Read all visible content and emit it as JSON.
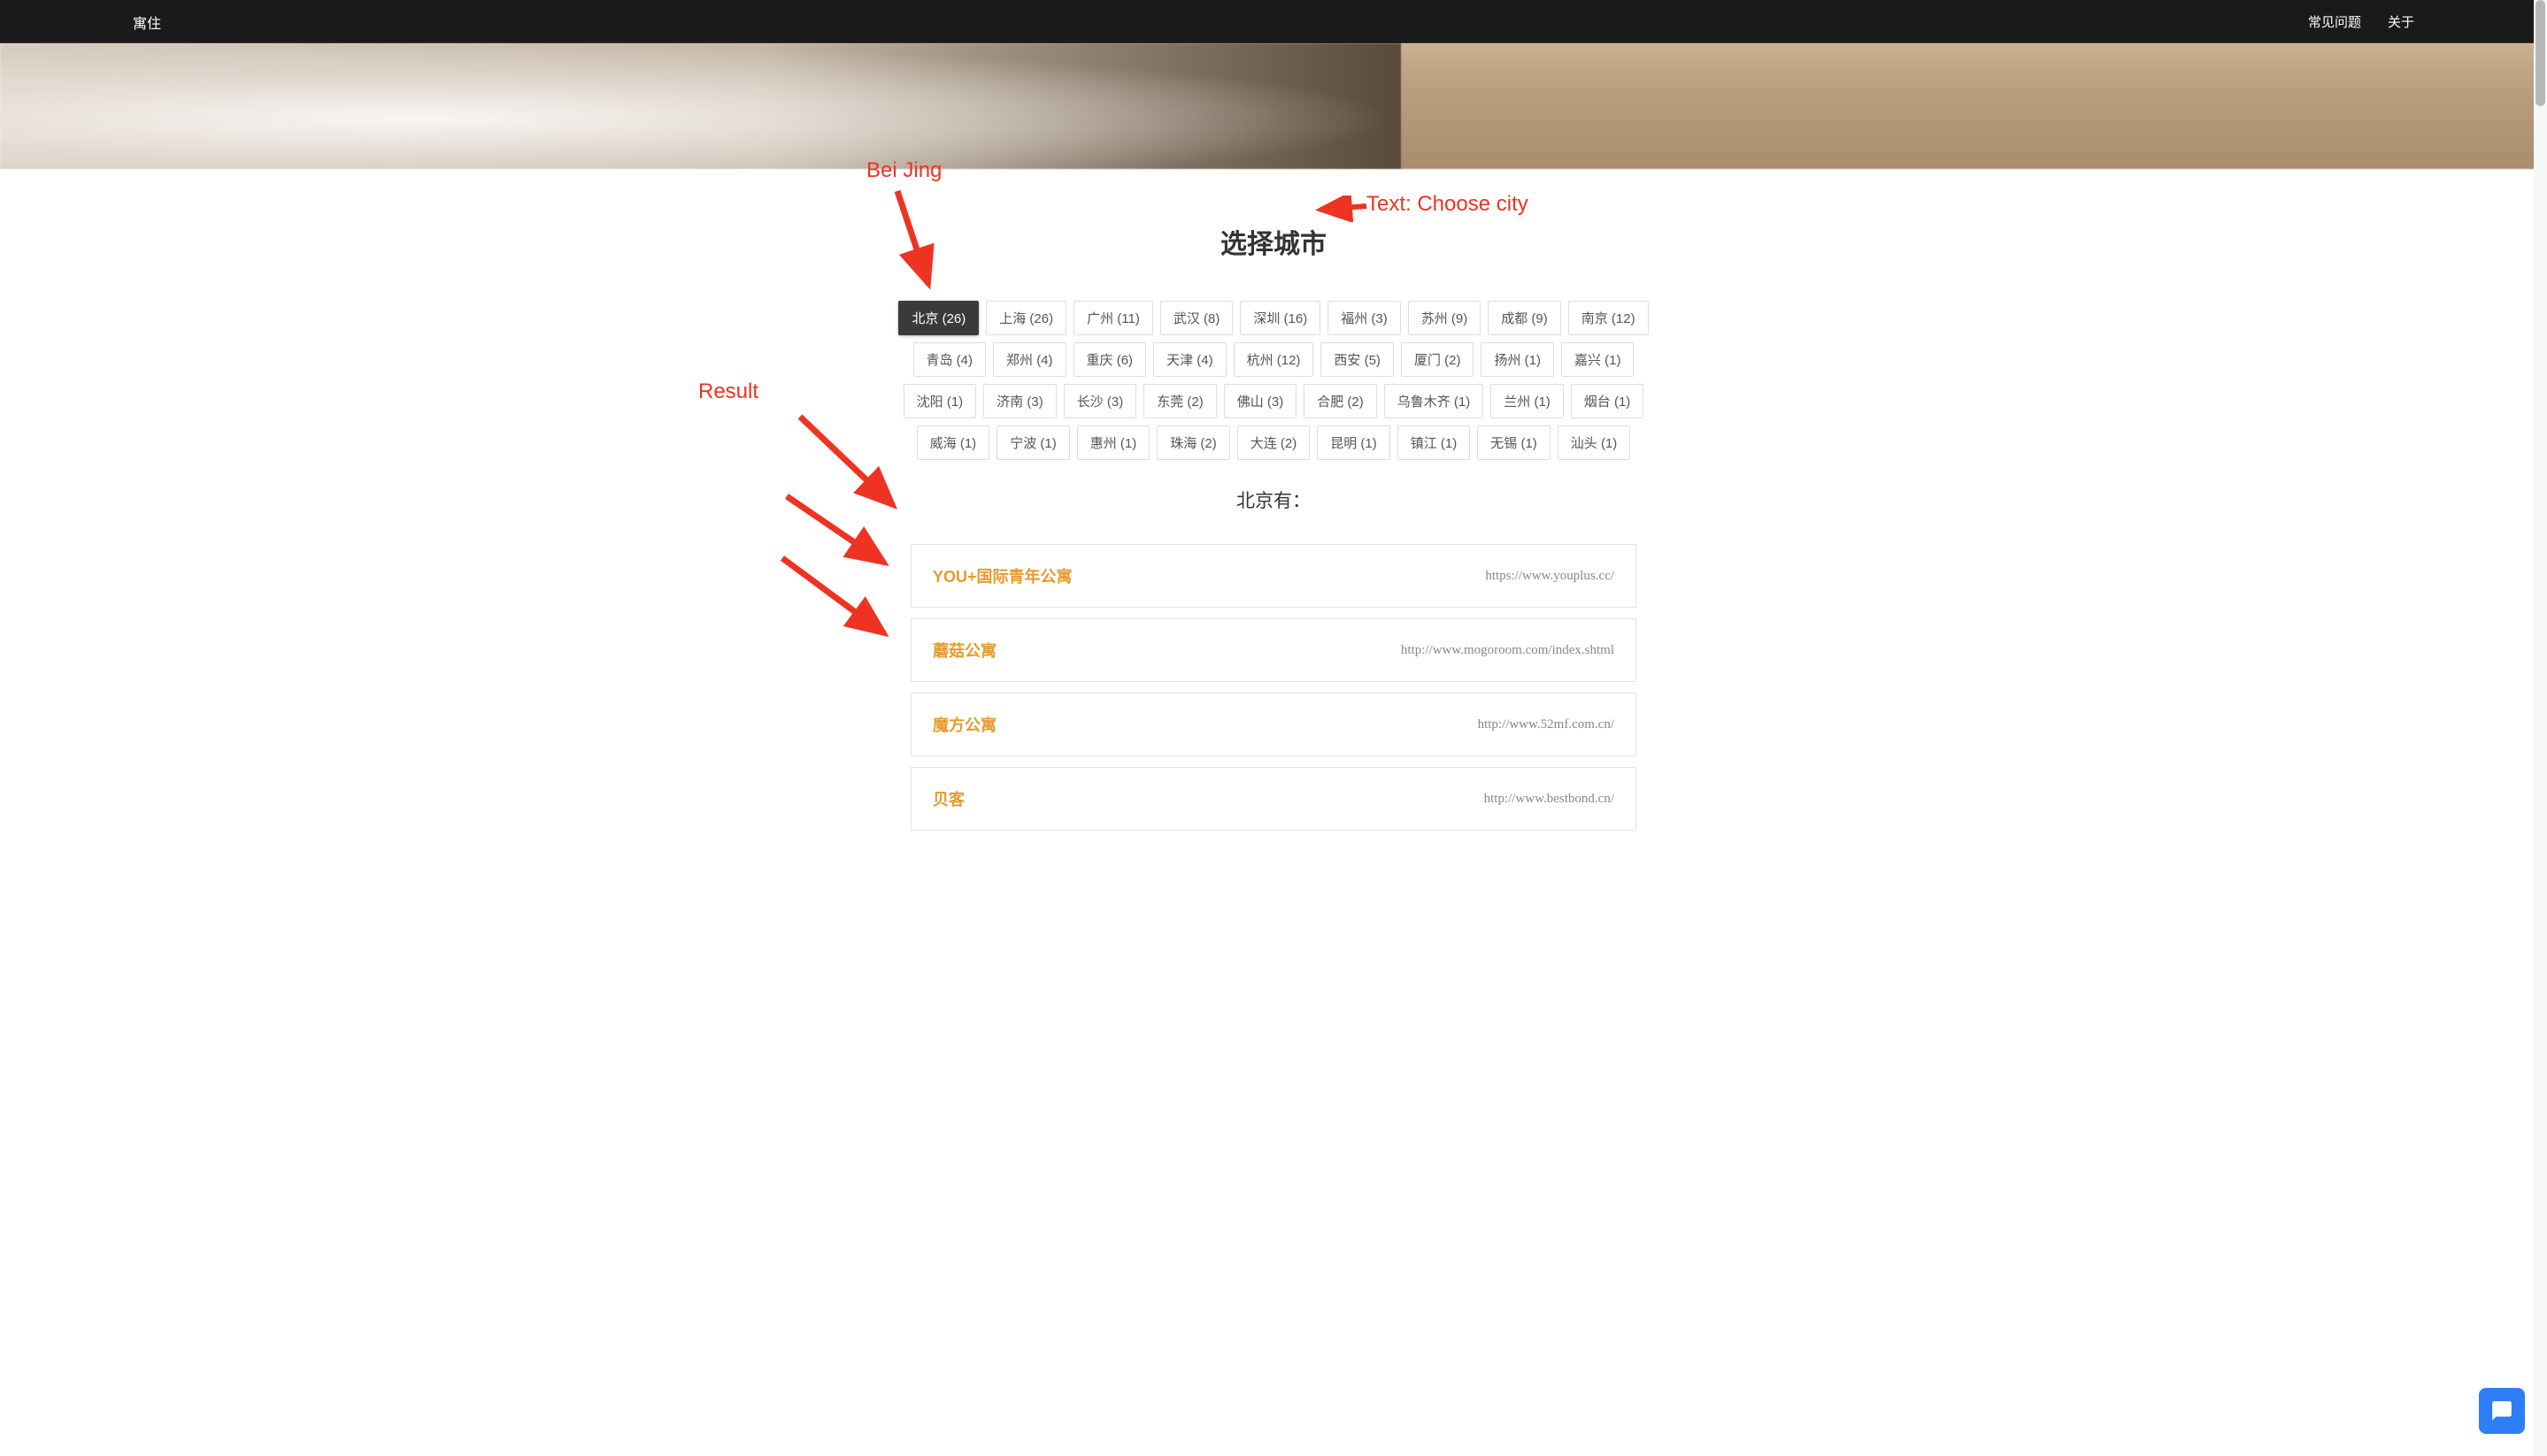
{
  "header": {
    "brand": "寓住",
    "nav": [
      {
        "label": "常见问题"
      },
      {
        "label": "关于"
      }
    ]
  },
  "section_title": "选择城市",
  "selected_city_label": "北京有：",
  "cities": [
    {
      "name": "北京",
      "count": 26,
      "active": true
    },
    {
      "name": "上海",
      "count": 26
    },
    {
      "name": "广州",
      "count": 11
    },
    {
      "name": "武汉",
      "count": 8
    },
    {
      "name": "深圳",
      "count": 16
    },
    {
      "name": "福州",
      "count": 3
    },
    {
      "name": "苏州",
      "count": 9
    },
    {
      "name": "成都",
      "count": 9
    },
    {
      "name": "南京",
      "count": 12
    },
    {
      "name": "青岛",
      "count": 4
    },
    {
      "name": "郑州",
      "count": 4
    },
    {
      "name": "重庆",
      "count": 6
    },
    {
      "name": "天津",
      "count": 4
    },
    {
      "name": "杭州",
      "count": 12
    },
    {
      "name": "西安",
      "count": 5
    },
    {
      "name": "厦门",
      "count": 2
    },
    {
      "name": "扬州",
      "count": 1
    },
    {
      "name": "嘉兴",
      "count": 1
    },
    {
      "name": "沈阳",
      "count": 1
    },
    {
      "name": "济南",
      "count": 3
    },
    {
      "name": "长沙",
      "count": 3
    },
    {
      "name": "东莞",
      "count": 2
    },
    {
      "name": "佛山",
      "count": 3
    },
    {
      "name": "合肥",
      "count": 2
    },
    {
      "name": "乌鲁木齐",
      "count": 1
    },
    {
      "name": "兰州",
      "count": 1
    },
    {
      "name": "烟台",
      "count": 1
    },
    {
      "name": "威海",
      "count": 1
    },
    {
      "name": "宁波",
      "count": 1
    },
    {
      "name": "惠州",
      "count": 1
    },
    {
      "name": "珠海",
      "count": 2
    },
    {
      "name": "大连",
      "count": 2
    },
    {
      "name": "昆明",
      "count": 1
    },
    {
      "name": "镇江",
      "count": 1
    },
    {
      "name": "无锡",
      "count": 1
    },
    {
      "name": "汕头",
      "count": 1
    }
  ],
  "results": [
    {
      "name": "YOU+国际青年公寓",
      "url": "https://www.youplus.cc/"
    },
    {
      "name": "蘑菇公寓",
      "url": "http://www.mogoroom.com/index.shtml"
    },
    {
      "name": "魔方公寓",
      "url": "http://www.52mf.com.cn/"
    },
    {
      "name": "贝客",
      "url": "http://www.bestbond.cn/"
    }
  ],
  "annotations": {
    "beijing": "Bei Jing",
    "choose_city": "Text: Choose city",
    "result": "Result"
  }
}
